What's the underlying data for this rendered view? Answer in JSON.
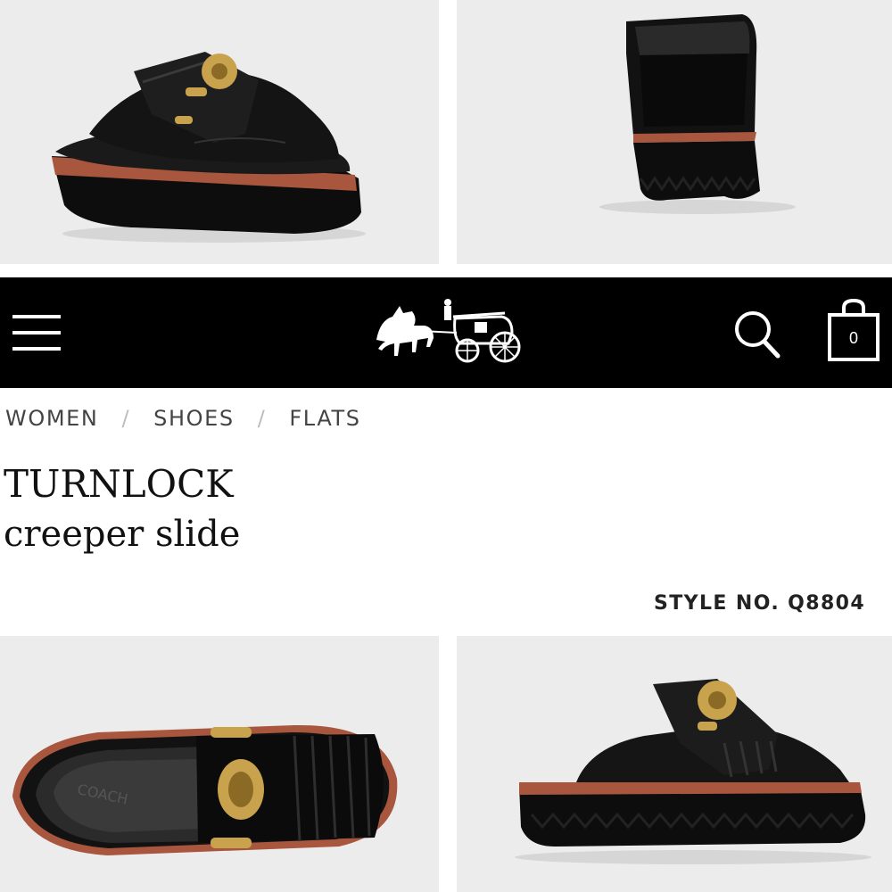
{
  "header": {
    "menu_icon": "hamburger-menu-icon",
    "logo_icon": "horse-and-carriage-logo",
    "search_icon": "search-icon",
    "bag_icon": "shopping-bag-icon",
    "bag_count": "0"
  },
  "breadcrumb": {
    "items": [
      "WOMEN",
      "SHOES",
      "FLATS"
    ],
    "separator": "/"
  },
  "product": {
    "title": "TURNLOCK",
    "subtitle": "creeper slide",
    "style_number": "STYLE NO. Q8804"
  },
  "images": [
    {
      "view": "three-quarter-front"
    },
    {
      "view": "back"
    },
    {
      "view": "top"
    },
    {
      "view": "side"
    }
  ],
  "colors": {
    "navbar": "#000000",
    "leather": "#111111",
    "welt": "#a8563e",
    "hardware": "#c9a24d",
    "tile_background": "#ececec"
  }
}
